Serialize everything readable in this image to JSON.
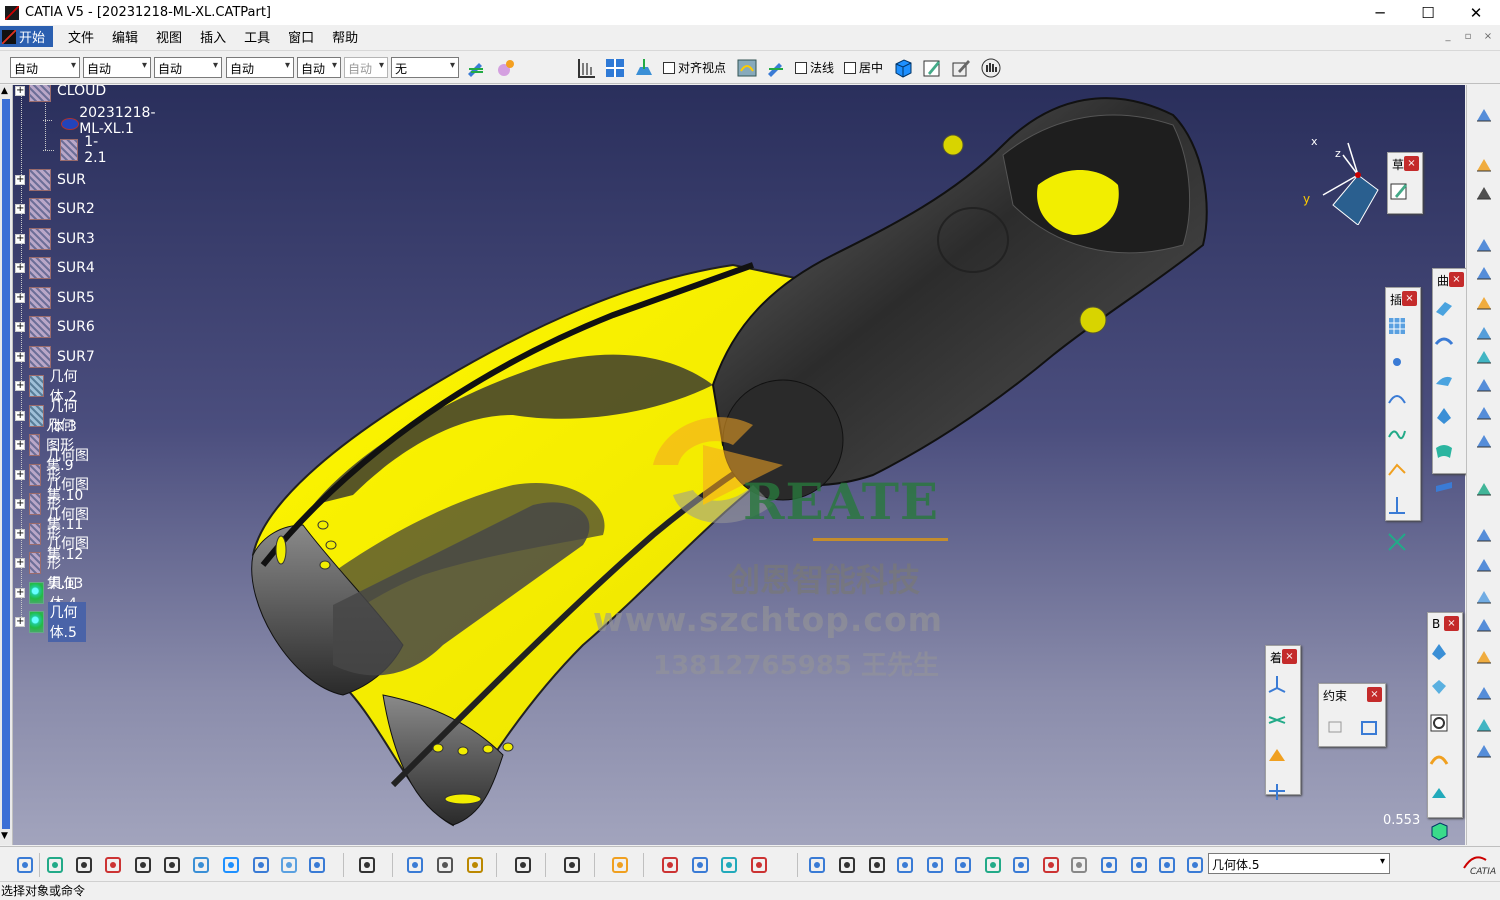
{
  "window": {
    "title": "CATIA V5 - [20231218-ML-XL.CATPart]",
    "controls": [
      "─",
      "☐",
      "✕"
    ]
  },
  "menu": {
    "start": "开始",
    "items": [
      "文件",
      "编辑",
      "视图",
      "插入",
      "工具",
      "窗口",
      "帮助"
    ]
  },
  "toolbar": {
    "dropdowns": [
      "自动",
      "自动",
      "自动",
      "自动",
      "自动",
      "自动",
      "无"
    ],
    "align_viewpoint": "对齐视点",
    "normal": "法线",
    "center": "居中"
  },
  "tree": {
    "items": [
      {
        "label": "CLOUD",
        "type": "set",
        "level": 0
      },
      {
        "label": "20231218-ML-XL.1",
        "type": "part",
        "level": 1
      },
      {
        "label": "1-2.1",
        "type": "set",
        "level": 1
      },
      {
        "label": "SUR",
        "type": "set",
        "level": 0
      },
      {
        "label": "SUR2",
        "type": "set",
        "level": 0
      },
      {
        "label": "SUR3",
        "type": "set",
        "level": 0
      },
      {
        "label": "SUR4",
        "type": "set",
        "level": 0
      },
      {
        "label": "SUR5",
        "type": "set",
        "level": 0
      },
      {
        "label": "SUR6",
        "type": "set",
        "level": 0
      },
      {
        "label": "SUR7",
        "type": "set",
        "level": 0
      },
      {
        "label": "几何体.2",
        "type": "body2",
        "level": 0
      },
      {
        "label": "几何体.3",
        "type": "body2",
        "level": 0
      },
      {
        "label": "几何图形集.9",
        "type": "set",
        "level": 0
      },
      {
        "label": "几何图形集.10",
        "type": "set",
        "level": 0
      },
      {
        "label": "几何图形集.11",
        "type": "set",
        "level": 0
      },
      {
        "label": "几何图形集.12",
        "type": "set",
        "level": 0
      },
      {
        "label": "几何图形集.13",
        "type": "set",
        "level": 0
      },
      {
        "label": "几何体.4",
        "type": "body",
        "level": 0
      },
      {
        "label": "几何体.5",
        "type": "body",
        "level": 0
      }
    ]
  },
  "watermark": {
    "brand": "REATE",
    "company": "创恩智能科技",
    "url": "www.szchtop.com",
    "phone": "13812765985 王先生"
  },
  "compass": {
    "x": "x",
    "y": "y",
    "z": "z"
  },
  "palettes": {
    "p1_title": "草",
    "p2_title": "曲",
    "p3_title": "插",
    "p4_title": "B",
    "p5_title": "着",
    "constraint_title": "约束",
    "close": "×"
  },
  "viewport": {
    "zoom_value": "0.553"
  },
  "bottom": {
    "current_body": "几何体.5"
  },
  "status": {
    "text": "选择对象或命令"
  },
  "colors": {
    "accent_yellow": "#f2ee00",
    "part_dark": "#3a3a3a",
    "bg_top": "#2a2f5c",
    "bg_bottom": "#a2a4bd",
    "close_red": "#c42b2b"
  }
}
